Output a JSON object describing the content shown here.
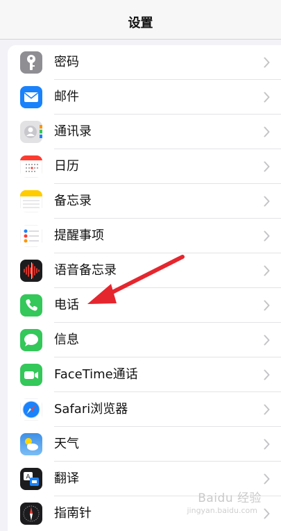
{
  "header": {
    "title": "设置"
  },
  "items": [
    {
      "label": "密码",
      "icon": "key-icon",
      "color": "#8e8e93"
    },
    {
      "label": "邮件",
      "icon": "mail-icon",
      "color": "#1a82fb"
    },
    {
      "label": "通讯录",
      "icon": "contacts-icon",
      "color": "#d5d5d8"
    },
    {
      "label": "日历",
      "icon": "calendar-icon",
      "color": "#ff3b30"
    },
    {
      "label": "备忘录",
      "icon": "notes-icon",
      "color": "#ffcc00"
    },
    {
      "label": "提醒事项",
      "icon": "reminders-icon",
      "color": "#ffffff"
    },
    {
      "label": "语音备忘录",
      "icon": "voice-memos-icon",
      "color": "#1c1c1e"
    },
    {
      "label": "电话",
      "icon": "phone-icon",
      "color": "#34c759"
    },
    {
      "label": "信息",
      "icon": "messages-icon",
      "color": "#34c759"
    },
    {
      "label": "FaceTime通话",
      "icon": "facetime-icon",
      "color": "#34c759"
    },
    {
      "label": "Safari浏览器",
      "icon": "safari-icon",
      "color": "#1a82fb"
    },
    {
      "label": "天气",
      "icon": "weather-icon",
      "color": "#3d8ed9"
    },
    {
      "label": "翻译",
      "icon": "translate-icon",
      "color": "#1c1c1e"
    },
    {
      "label": "指南针",
      "icon": "compass-icon",
      "color": "#1c1c1e"
    }
  ],
  "annotation": {
    "color": "#e5262e"
  },
  "watermark": {
    "text": "Baidu 经验",
    "sub": "jingyan.baidu.com"
  }
}
